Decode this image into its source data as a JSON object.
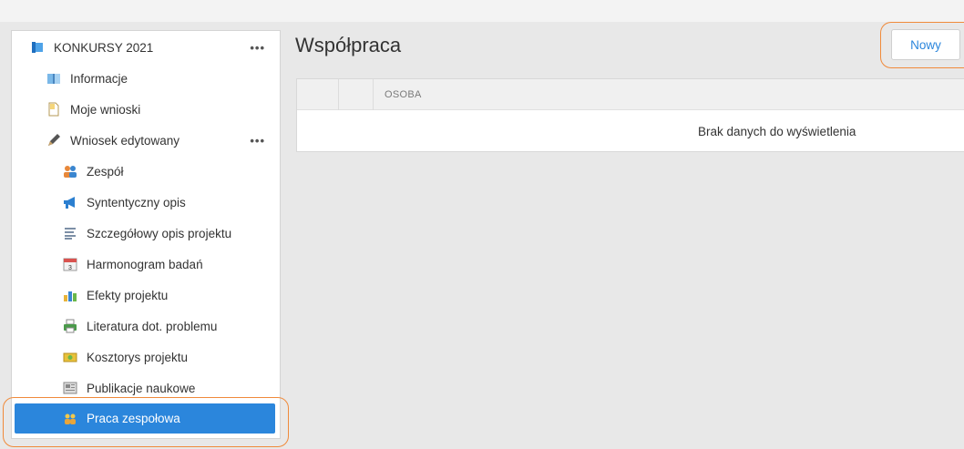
{
  "sidebar": {
    "root": {
      "label": "KONKURSY 2021",
      "icon": "book-blue-icon",
      "menu": "•••"
    },
    "items": [
      {
        "label": "Informacje",
        "icon": "open-book-icon"
      },
      {
        "label": "Moje wnioski",
        "icon": "document-icon"
      },
      {
        "label": "Wniosek edytowany",
        "icon": "pencil-icon",
        "menu": "•••"
      }
    ],
    "subitems": [
      {
        "label": "Zespół",
        "icon": "team-icon"
      },
      {
        "label": "Syntentyczny opis",
        "icon": "megaphone-icon"
      },
      {
        "label": "Szczegółowy opis projektu",
        "icon": "text-lines-icon"
      },
      {
        "label": "Harmonogram badań",
        "icon": "calendar-icon"
      },
      {
        "label": "Efekty projektu",
        "icon": "bar-chart-icon"
      },
      {
        "label": "Literatura dot. problemu",
        "icon": "printer-icon"
      },
      {
        "label": "Kosztorys projektu",
        "icon": "money-icon"
      },
      {
        "label": "Publikacje naukowe",
        "icon": "newspaper-icon"
      },
      {
        "label": "Praca zespołowa",
        "icon": "people-icon",
        "active": true
      }
    ]
  },
  "main": {
    "title": "Współpraca",
    "new_button": "Nowy",
    "grid": {
      "columns": [
        "",
        "",
        "OSOBA"
      ],
      "empty_message": "Brak danych do wyświetlenia"
    }
  },
  "colors": {
    "accent": "#2b86dc",
    "highlight": "#f08a3a"
  }
}
